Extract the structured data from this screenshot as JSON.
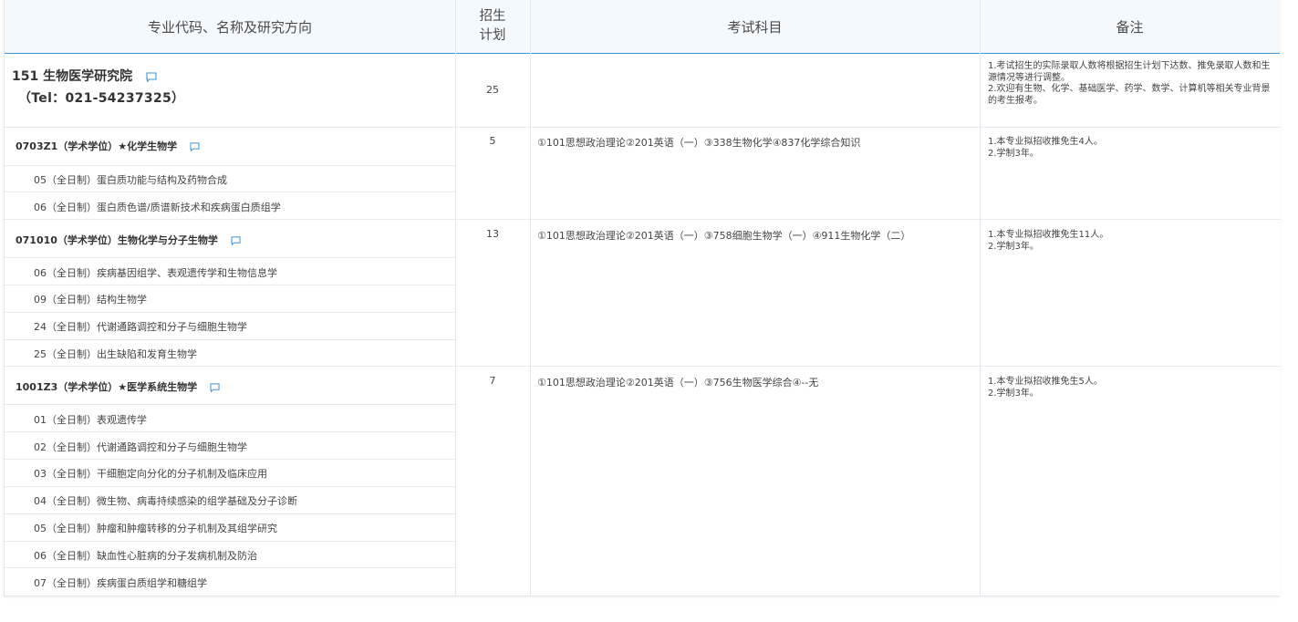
{
  "header": {
    "col_major": "专业代码、名称及研究方向",
    "col_plan_line1": "招生",
    "col_plan_line2": "计划",
    "col_exam": "考试科目",
    "col_notes": "备注"
  },
  "institute": {
    "name": "151 生物医学研究院",
    "tel": "（Tel：021-54237325）",
    "plan": "25",
    "notes": [
      "1.考试招生的实际录取人数将根据招生计划下达数、推免录取人数和生源情况等进行调整。",
      "2.欢迎有生物、化学、基础医学、药学、数学、计算机等相关专业背景的考生报考。"
    ]
  },
  "majors": [
    {
      "title": "0703Z1（学术学位）★化学生物学",
      "plan": "5",
      "exam": "①101思想政治理论②201英语（一）③338生物化学④837化学综合知识",
      "notes": [
        "1.本专业拟招收推免生4人。",
        "2.学制3年。"
      ],
      "directions": [
        "05（全日制）蛋白质功能与结构及药物合成",
        "06（全日制）蛋白质色谱/质谱新技术和疾病蛋白质组学"
      ]
    },
    {
      "title": "071010（学术学位）生物化学与分子生物学",
      "plan": "13",
      "exam": "①101思想政治理论②201英语（一）③758细胞生物学（一）④911生物化学（二）",
      "notes": [
        "1.本专业拟招收推免生11人。",
        "2.学制3年。"
      ],
      "directions": [
        "06（全日制）疾病基因组学、表观遗传学和生物信息学",
        "09（全日制）结构生物学",
        "24（全日制）代谢通路调控和分子与细胞生物学",
        "25（全日制）出生缺陷和发育生物学"
      ]
    },
    {
      "title": "1001Z3（学术学位）★医学系统生物学",
      "plan": "7",
      "exam": "①101思想政治理论②201英语（一）③756生物医学综合④--无",
      "notes": [
        "1.本专业拟招收推免生5人。",
        "2.学制3年。"
      ],
      "directions": [
        "01（全日制）表观遗传学",
        "02（全日制）代谢通路调控和分子与细胞生物学",
        "03（全日制）干细胞定向分化的分子机制及临床应用",
        "04（全日制）微生物、病毒持续感染的组学基础及分子诊断",
        "05（全日制）肿瘤和肿瘤转移的分子机制及其组学研究",
        "06（全日制）缺血性心脏病的分子发病机制及防治",
        "07（全日制）疾病蛋白质组学和糖组学"
      ]
    }
  ],
  "colors": {
    "header_bg": "#f4f9fe",
    "header_rule": "#3f95d6",
    "grid": "#e3e8ee",
    "icon": "#3f95d6"
  }
}
